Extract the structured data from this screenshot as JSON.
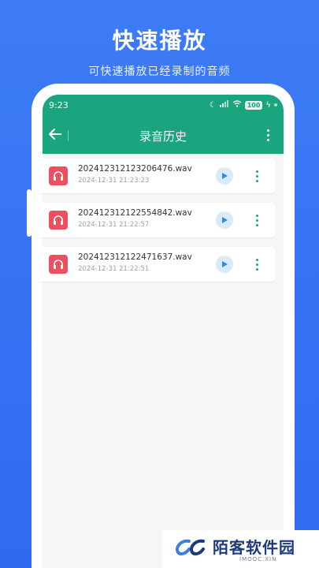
{
  "promo": {
    "title": "快速播放",
    "subtitle": "可快速播放已经录制的音频"
  },
  "status_bar": {
    "time": "9:23",
    "battery": "100"
  },
  "app_bar": {
    "title": "录音历史"
  },
  "recordings": [
    {
      "name": "20241231212320​6476.wav",
      "date": "2024-12-31 21:23:23"
    },
    {
      "name": "20241231212255​4842.wav",
      "date": "2024-12-31 21:22:57"
    },
    {
      "name": "20241231212247​1637.wav",
      "date": "2024-12-31 21:22:51"
    }
  ],
  "watermark": {
    "name": "陌客软件园",
    "sub": "IMOOC.XIN"
  },
  "colors": {
    "background": "#3d7cf5",
    "header": "#1aa57f",
    "record_icon": "#ee4f5e",
    "play_bg": "#d7ebfb",
    "play_icon": "#2b8ce6"
  }
}
